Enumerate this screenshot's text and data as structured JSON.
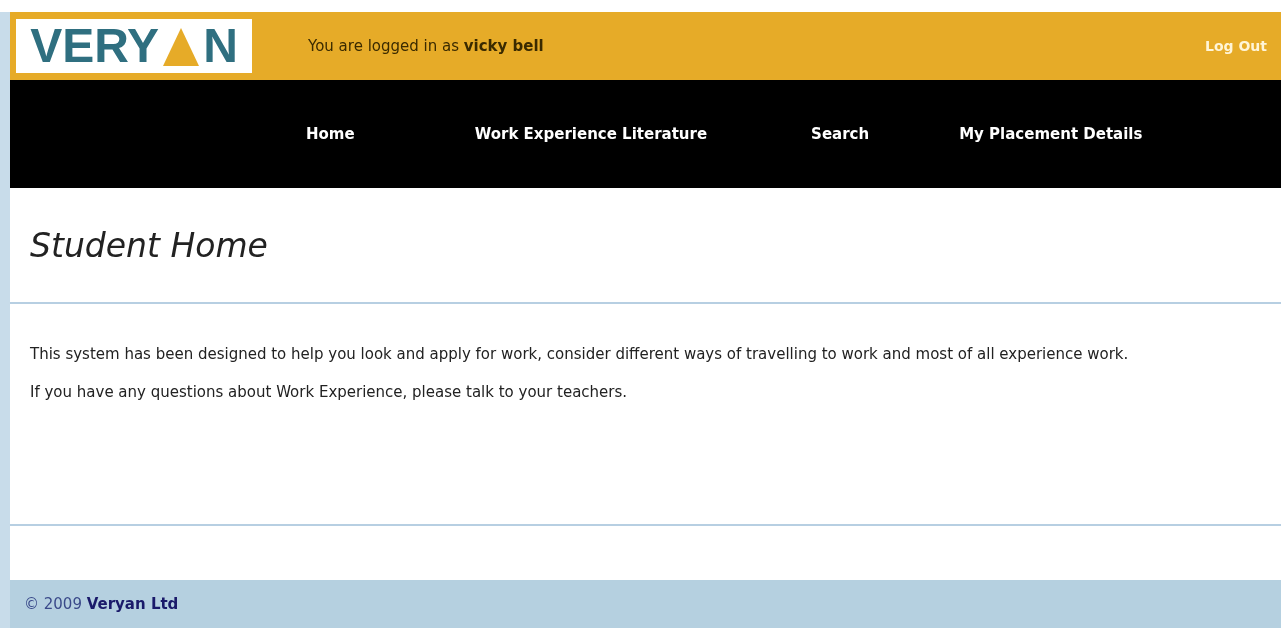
{
  "header": {
    "logo": {
      "before": "VERY",
      "after": "N"
    },
    "login_text": "You are logged in as **vicky bell**",
    "logout": "Log Out"
  },
  "nav": {
    "items": [
      {
        "label": "Home"
      },
      {
        "label": "Work Experience Literature"
      },
      {
        "label": "Search"
      },
      {
        "label": "My Placement Details"
      }
    ]
  },
  "page_title": "Student Home",
  "paragraphs": [
    "This system has been designed to help you look and apply for work, consider different ways of travelling to work and most of all experience work.",
    "If you have any questions about Work Experience, please talk to your teachers."
  ],
  "footer": {
    "text": "© 2009 **Veryan Ltd**"
  }
}
